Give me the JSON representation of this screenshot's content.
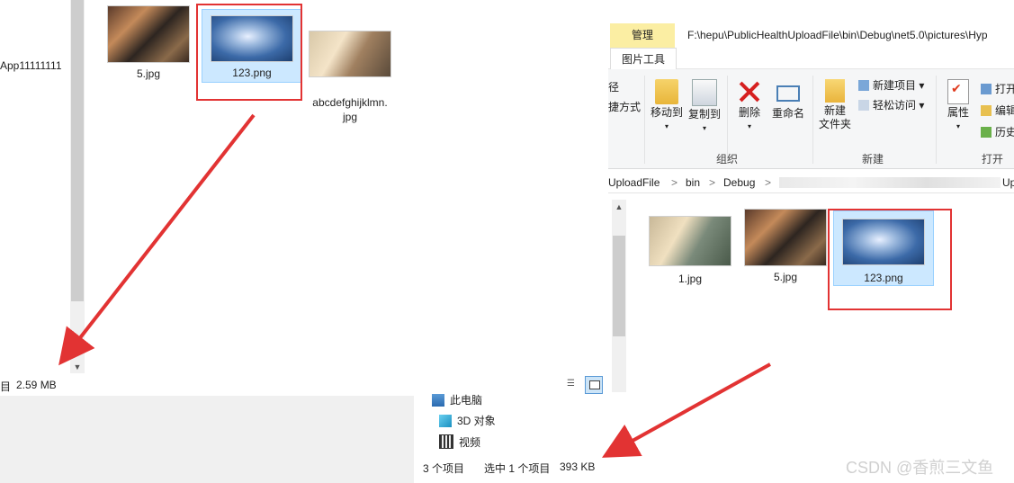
{
  "left_window": {
    "nav_truncated_item": "App11111111",
    "files": [
      {
        "name": "5.jpg"
      },
      {
        "name": "123.png",
        "selected": true
      },
      {
        "name": "abcdefghijklmn.\njpg"
      }
    ],
    "status_left": "目",
    "status_size": "2.59 MB"
  },
  "right_window": {
    "tabs": {
      "manage": "管理",
      "picture_tools": "图片工具"
    },
    "title_path": "F:\\hepu\\PublicHealthUploadFile\\bin\\Debug\\net5.0\\pictures\\Hyp",
    "ribbon": {
      "partial_left_top": "径",
      "partial_left_bottom": "捷方式",
      "move_to": "移动到",
      "copy_to": "复制到",
      "delete": "删除",
      "rename": "重命名",
      "new_folder_line1": "新建",
      "new_folder_line2": "文件夹",
      "new_item": "新建项目 ▾",
      "easy_access": "轻松访问 ▾",
      "properties": "属性",
      "open": "打开",
      "edit": "编辑",
      "history": "历史",
      "group_organize": "组织",
      "group_new": "新建",
      "group_open": "打开"
    },
    "address": {
      "seg1": "UploadFile",
      "seg2": "bin",
      "seg3": "Debug",
      "seg_end": "Up",
      "chev": ">"
    },
    "files": [
      {
        "name": "1.jpg"
      },
      {
        "name": "5.jpg"
      },
      {
        "name": "123.png",
        "selected": true
      }
    ],
    "nav_items": {
      "pc": "此电脑",
      "objects3d": "3D 对象",
      "videos": "视频"
    },
    "status": {
      "count": "3 个项目",
      "selected": "选中 1 个项目",
      "size": "393 KB"
    }
  },
  "watermark": "CSDN @香煎三文鱼",
  "colors": {
    "highlight_box": "#e23333",
    "selection": "#cce8ff",
    "manage_tab": "#fbeea3"
  }
}
